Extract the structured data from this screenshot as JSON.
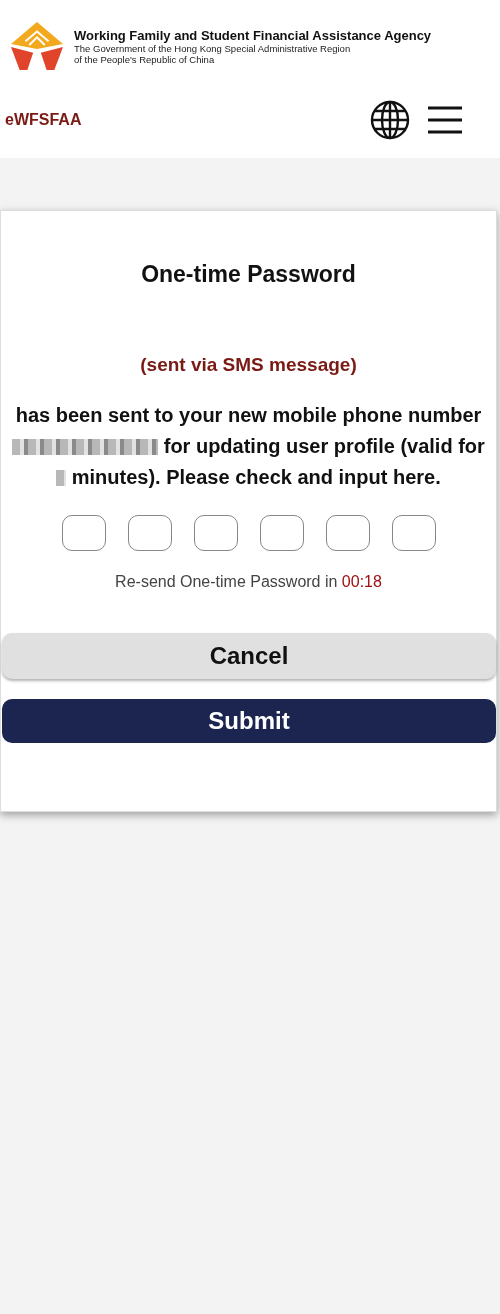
{
  "header": {
    "agency_name": "Working Family and Student Financial Assistance Agency",
    "government_line_1": "The Government of the Hong Kong Special Administrative Region",
    "government_line_2": "of the People's Republic of China",
    "app_name": "eWFSFAA"
  },
  "dialog": {
    "title": "One-time Password",
    "channel_note": "(sent via SMS message)",
    "message": [
      {
        "kind": "text",
        "text": "has been sent to your new mobile phone number"
      },
      {
        "kind": "redacted"
      },
      {
        "kind": "text",
        "text": "for updating user profile (valid for"
      },
      {
        "kind": "redacted"
      },
      {
        "kind": "text",
        "text": "minutes). Please check and input here."
      }
    ],
    "otp_fields": [
      {
        "kind": "digit"
      },
      {
        "kind": "digit"
      },
      {
        "kind": "digit"
      },
      {
        "kind": "digit"
      },
      {
        "kind": "digit"
      },
      {
        "kind": "digit"
      }
    ],
    "resend_label": "Re-send One-time Password in",
    "countdown": "00:18",
    "buttons": [
      {
        "kind": "secondary",
        "label": "Cancel"
      },
      {
        "kind": "primary",
        "label": "Submit"
      }
    ]
  }
}
